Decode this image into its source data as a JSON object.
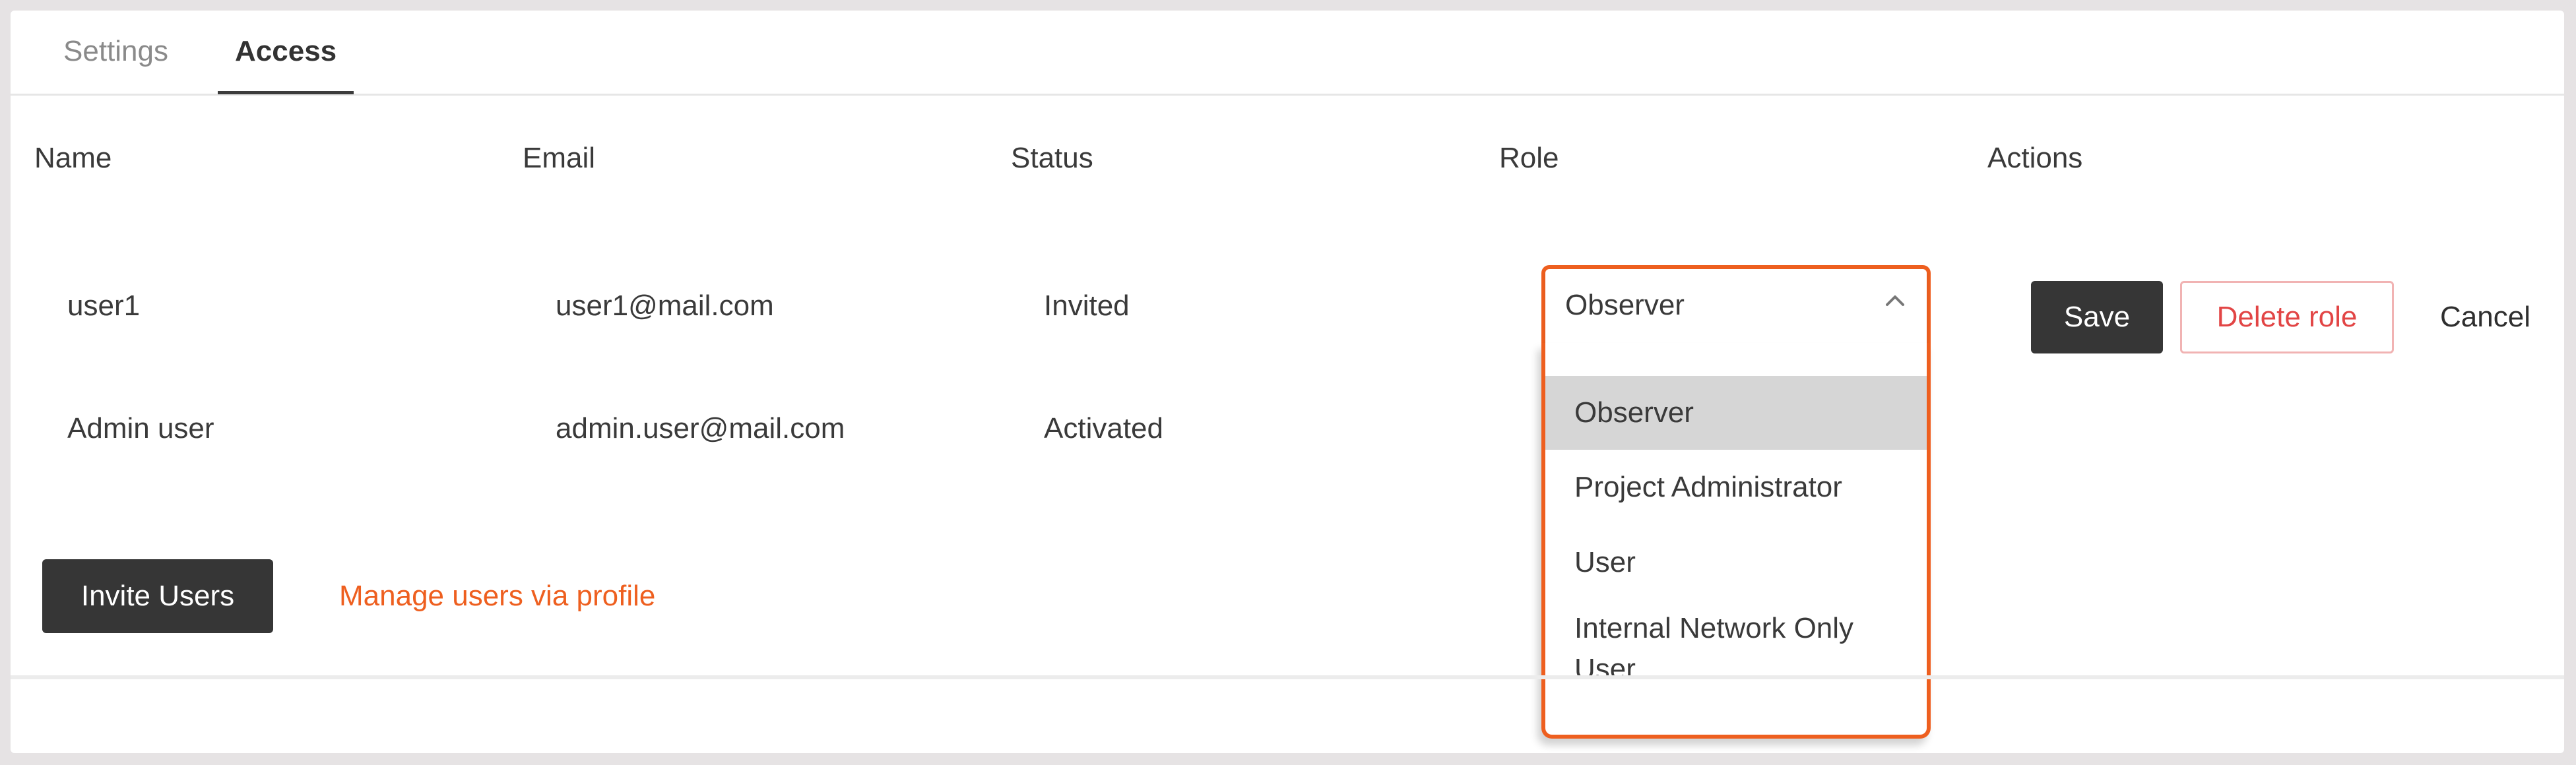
{
  "tabs": [
    {
      "label": "Settings",
      "active": false
    },
    {
      "label": "Access",
      "active": true
    }
  ],
  "table": {
    "headers": [
      "Name",
      "Email",
      "Status",
      "Role",
      "Actions"
    ],
    "rows": [
      {
        "name": "user1",
        "email": "user1@mail.com",
        "status": "Invited"
      },
      {
        "name": "Admin user",
        "email": "admin.user@mail.com",
        "status": "Activated"
      }
    ]
  },
  "role_select": {
    "value": "Observer",
    "options": [
      "Observer",
      "Project Administrator",
      "User",
      "Internal Network Only User"
    ],
    "icon": "chevron-up-icon"
  },
  "actions": {
    "save": "Save",
    "delete_role": "Delete role",
    "cancel": "Cancel"
  },
  "footer": {
    "invite": "Invite Users",
    "manage_link": "Manage users via profile"
  },
  "colors": {
    "accent": "#ee5f1f",
    "dark_button": "#363636",
    "danger": "#e24545"
  }
}
